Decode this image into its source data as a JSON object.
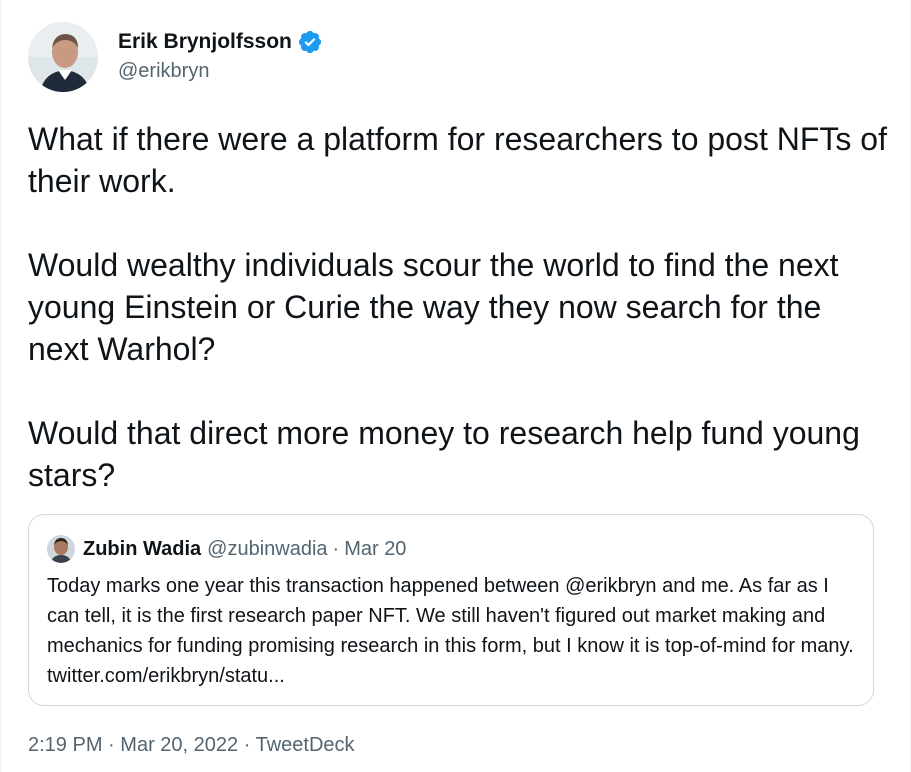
{
  "author": {
    "display_name": "Erik Brynjolfsson",
    "handle": "@erikbryn",
    "verified": true
  },
  "tweet": {
    "paragraphs": [
      "What if there were a platform for researchers to post NFTs of their work.",
      "Would wealthy individuals scour the world to find the next young Einstein or Curie the way they now search for the next Warhol?",
      "Would that direct more money to research help fund young stars?"
    ]
  },
  "quoted": {
    "display_name": "Zubin Wadia",
    "handle": "@zubinwadia",
    "separator": "·",
    "date": "Mar 20",
    "text": "Today marks one year this transaction happened between @erikbryn and me. As far as I can tell, it is the first research paper NFT. We still haven't figured out market making and mechanics for funding promising research in this form, but I know it is top-of-mind for many. twitter.com/erikbryn/statu..."
  },
  "meta": {
    "time": "2:19 PM",
    "separator": "·",
    "date": "Mar 20, 2022",
    "source": "TweetDeck"
  },
  "colors": {
    "verified_blue": "#1d9bf0",
    "secondary_text": "#536471",
    "primary_text": "#0f1419",
    "border": "#cfd9de"
  },
  "icons": {
    "verified": "verified-badge-icon"
  }
}
